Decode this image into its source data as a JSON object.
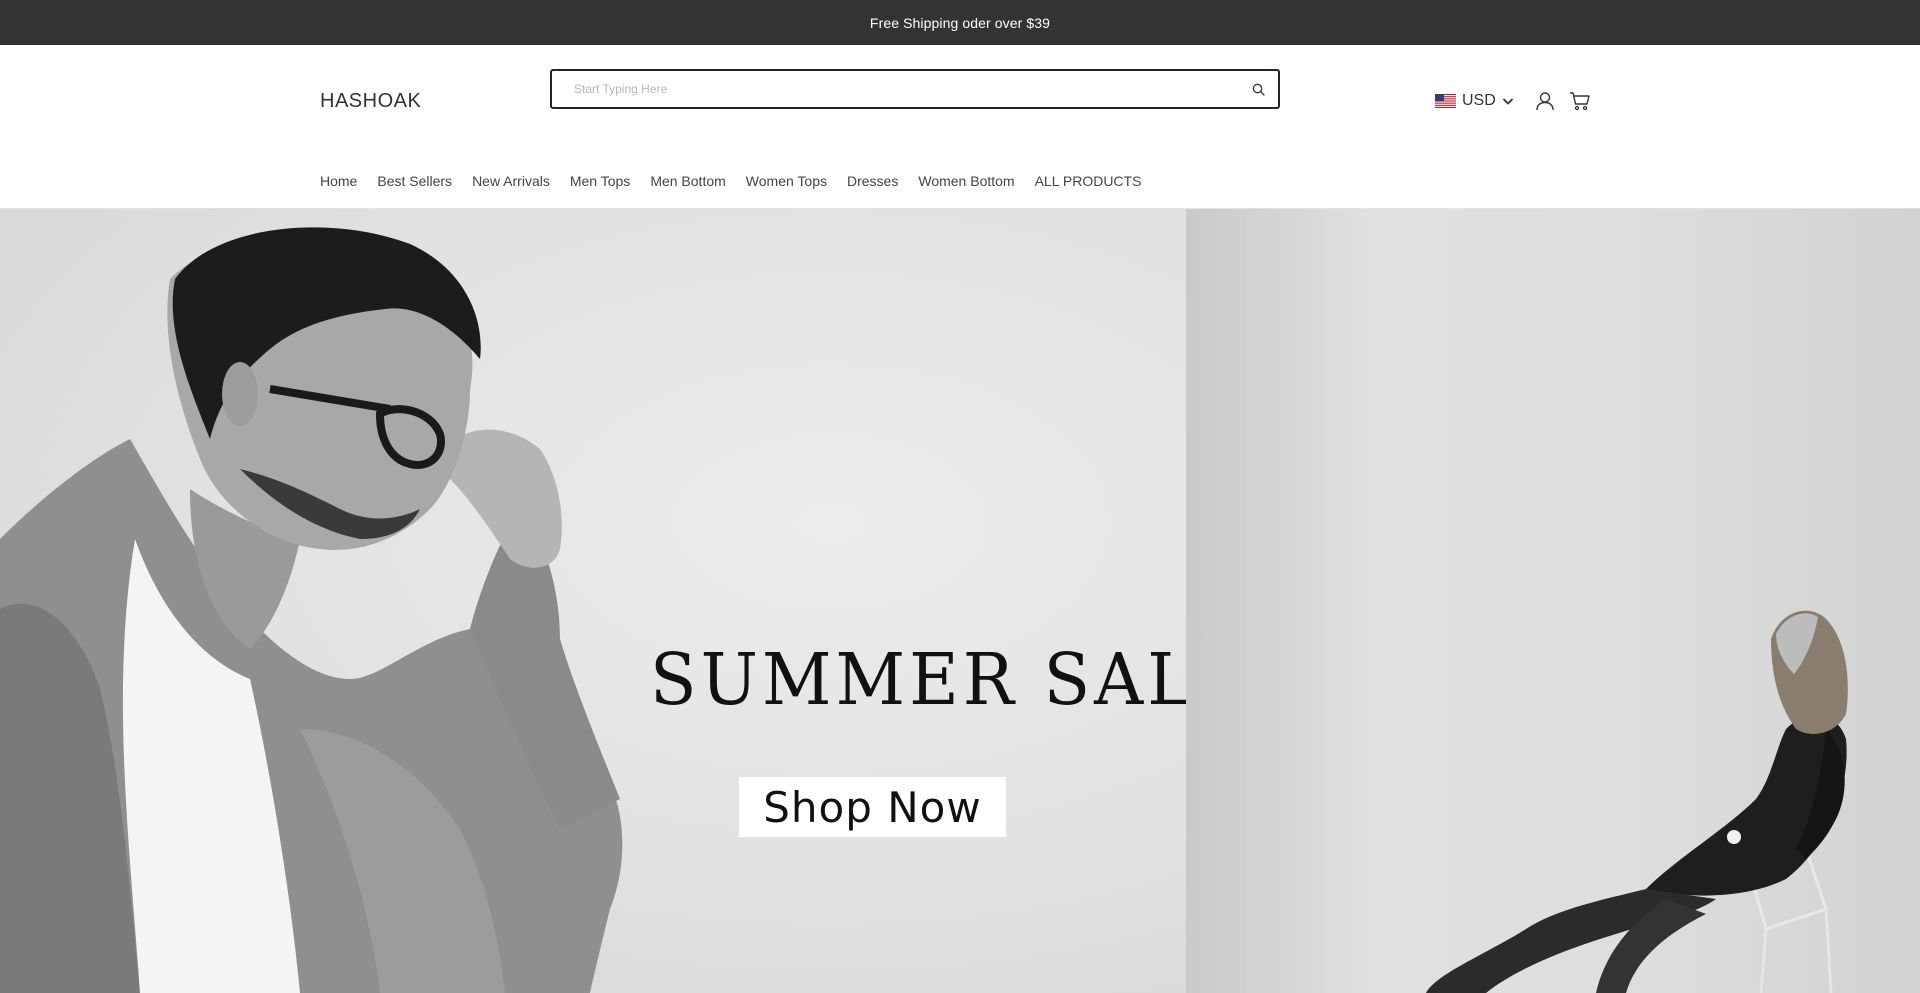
{
  "announcement": {
    "text": "Free Shipping oder over $39"
  },
  "header": {
    "logo": "HASHOAK",
    "search": {
      "placeholder": "Start Typing Here",
      "value": ""
    },
    "currency": {
      "code": "USD",
      "flag": "us-flag-icon"
    },
    "icons": [
      "search-icon",
      "chevron-down-icon",
      "account-icon",
      "cart-icon"
    ]
  },
  "nav": {
    "items": [
      {
        "label": "Home"
      },
      {
        "label": "Best Sellers"
      },
      {
        "label": "New Arrivals"
      },
      {
        "label": "Men Tops"
      },
      {
        "label": "Men Bottom"
      },
      {
        "label": "Women Tops"
      },
      {
        "label": "Dresses"
      },
      {
        "label": "Women Bottom"
      },
      {
        "label": "ALL PRODUCTS"
      }
    ]
  },
  "hero": {
    "title": "SUMMER SALE",
    "button_label": "Shop Now"
  },
  "colors": {
    "announcement_bg": "#333333",
    "search_border": "#2a2420",
    "text": "#333333"
  }
}
